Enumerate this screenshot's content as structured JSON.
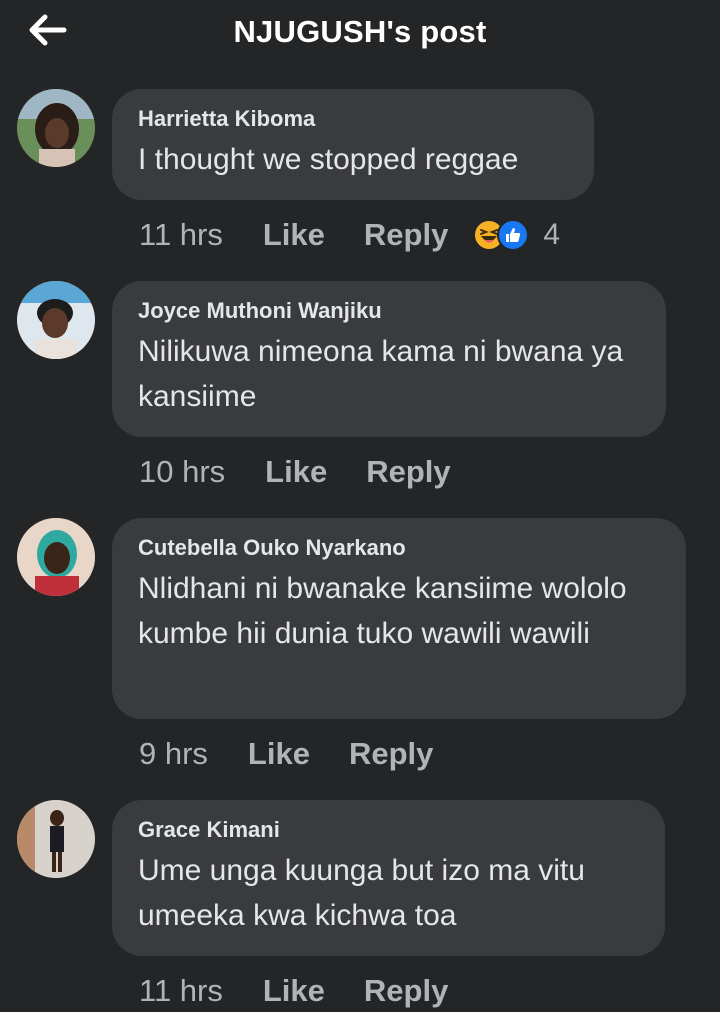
{
  "header": {
    "title": "NJUGUSH's post",
    "back_icon": "arrow-left-icon"
  },
  "comments": [
    {
      "author": "Harrietta Kiboma",
      "text": "I thought we stopped reggae",
      "time": "11 hrs",
      "like_label": "Like",
      "reply_label": "Reply",
      "reactions": [
        "laughing-face-icon",
        "thumbs-up-icon"
      ],
      "reaction_count": "4"
    },
    {
      "author": "Joyce Muthoni Wanjiku",
      "text": "Nilikuwa nimeona kama ni bwana ya kansiime",
      "time": "10 hrs",
      "like_label": "Like",
      "reply_label": "Reply"
    },
    {
      "author": "Cutebella Ouko Nyarkano",
      "text": "Nlidhani ni bwanake kansiime wololo kumbe hii dunia tuko wawili wawili",
      "time": "9 hrs",
      "like_label": "Like",
      "reply_label": "Reply"
    },
    {
      "author": "Grace Kimani",
      "text": "Ume unga kuunga but izo ma vitu umeeka kwa kichwa toa",
      "time": "11 hrs",
      "like_label": "Like",
      "reply_label": "Reply"
    }
  ],
  "colors": {
    "background": "#242526",
    "bubble": "#3a3b3c",
    "text": "#e4e6eb",
    "secondary_text": "#b0b3b8",
    "like_blue": "#1877f2",
    "haha_yellow": "#f7b125"
  }
}
